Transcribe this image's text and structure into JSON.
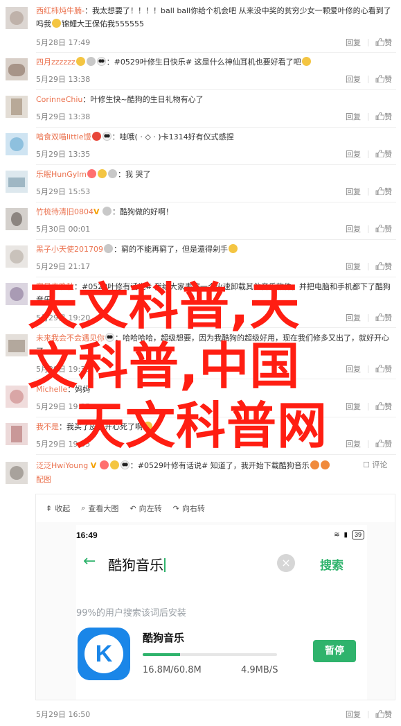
{
  "comments": [
    {
      "username": "西红柿炖牛腩-",
      "text": "：我太想要了！！！！ball  ball你给个机会吧 从来没中奖的贫穷少女一颗爱叶修的心看到了吗我",
      "emoji_after": "",
      "text_tail": "锦鲤大王保佑我555555",
      "time": "5月28日 17:49",
      "reply": "回复",
      "like": "赞"
    },
    {
      "username": "四月zzzzzz",
      "text": "：#0529叶修生日快乐# 这是什么神仙耳机也要好看了吧",
      "time": "5月29日 13:38",
      "reply": "回复",
      "like": "赞"
    },
    {
      "username": "CorinneChiu",
      "text": "：叶修生快~酷狗的生日礼物有心了",
      "time": "5月29日 13:38",
      "reply": "回复",
      "like": "赞"
    },
    {
      "username": "喑食双喵little馒",
      "text": "：哇哦( · ◇ · )卡1314好有仪式感捏",
      "time": "5月29日 13:35",
      "reply": "回复",
      "like": "赞"
    },
    {
      "username": "乐眠HunGylm",
      "text": "：我    哭了",
      "time": "5月29日 15:53",
      "reply": "回复",
      "like": "赞"
    },
    {
      "username": "竹梳待清旧0804",
      "text": "：酷狗做的好啊！",
      "time": "5月30日 00:01",
      "reply": "回复",
      "like": "赞"
    },
    {
      "username": "黑子小天使201709",
      "text": "：窮的不能再窮了，但是還得剁手",
      "time": "5月29日 21:17",
      "reply": "回复",
      "like": "赞"
    },
    {
      "username": "寒风恋晚秋",
      "text": "：#0529叶修有话说# 我给大家表演一个火速卸载其他音乐软件，并把电脑和手机都下了酷狗音乐！",
      "time": "5月29日 19:20",
      "reply": "回复",
      "like": "赞"
    },
    {
      "username": "未来我会不会遇见你",
      "text": "：哈哈哈哈，超级想要，因为我酷狗的超级好用，现在我们修多又出了，就好开心了",
      "time": "5月29日 19:35",
      "reply": "回复",
      "like": "赞"
    },
    {
      "username": "Michelle",
      "text": "：妈妈",
      "time": "5月29日 19:35",
      "reply": "回复",
      "like": "赞"
    },
    {
      "username": "我不是",
      "text": "：我买了皮肤开心死了啊",
      "time": "5月29日 19:35",
      "reply": "回复",
      "like": "赞"
    },
    {
      "username": "泛泛HwiYoung",
      "text": "：#0529叶修有话说# 知道了，我开始下载酷狗音乐",
      "time": "",
      "reply": "",
      "like": "",
      "comment_label": "评论",
      "image_label": "配图"
    }
  ],
  "embed": {
    "toolbar": {
      "collapse": "收起",
      "view_large": "查看大图",
      "rotate_left": "向左转",
      "rotate_right": "向右转"
    },
    "phone": {
      "clock": "16:49",
      "battery": "39",
      "query": "酷狗音乐",
      "search_button": "搜索",
      "hint": "99%的用户搜索该词后安装",
      "app_name": "酷狗音乐",
      "app_icon_letter": "K",
      "progress_fraction": 0.28,
      "download_size": "16.8M/60.8M",
      "download_speed": "4.9MB/S",
      "pause_button": "暂停"
    }
  },
  "last_comment_meta": {
    "time": "5月29日 16:50",
    "reply": "回复",
    "like": "赞"
  },
  "watermark": {
    "line1": "天文科普,天",
    "line2": "文科普,中国",
    "line3": "天文科普网"
  },
  "colors": {
    "username": "#eb7350",
    "watermark": "#ff1e12",
    "accent_green": "#2fb36c",
    "kugou_blue": "#1a86e8"
  }
}
